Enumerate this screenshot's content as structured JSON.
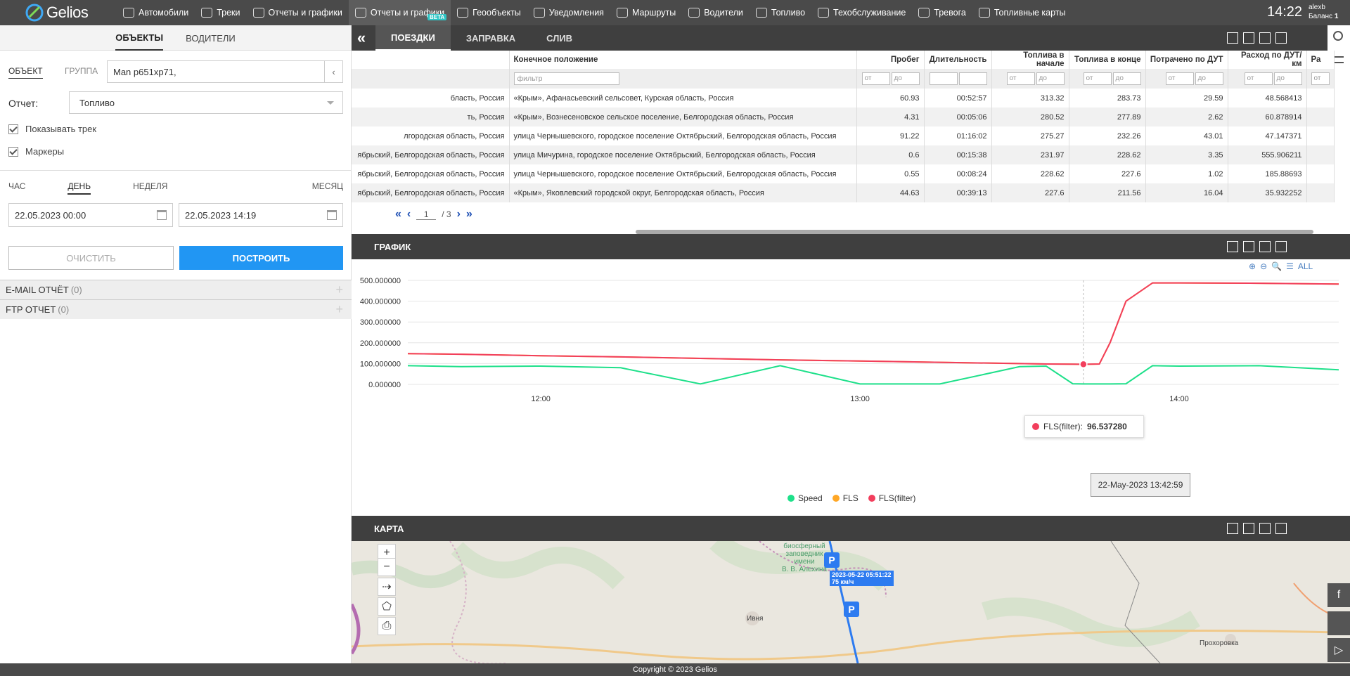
{
  "app": {
    "name": "Gelios",
    "clock": "14:22",
    "user": "alexb",
    "balance_label": "Баланс",
    "balance_value": "1"
  },
  "nav": [
    {
      "label": "Автомобили",
      "icon": "car-icon"
    },
    {
      "label": "Треки",
      "icon": "road-icon"
    },
    {
      "label": "Отчеты и графики",
      "icon": "chart-icon"
    },
    {
      "label": "Отчеты и графики",
      "icon": "chart-icon",
      "badge": "BETA",
      "active": true
    },
    {
      "label": "Геообъекты",
      "icon": "pin-icon"
    },
    {
      "label": "Уведомления",
      "icon": "bell-icon"
    },
    {
      "label": "Маршруты",
      "icon": "route-icon"
    },
    {
      "label": "Водители",
      "icon": "user-icon"
    },
    {
      "label": "Топливо",
      "icon": "fuel-icon"
    },
    {
      "label": "Техобслуживание",
      "icon": "wrench-icon"
    },
    {
      "label": "Тревога",
      "icon": "alarm-icon"
    },
    {
      "label": "Топливные карты",
      "icon": "card-icon"
    }
  ],
  "left": {
    "tabs": [
      "ОБЪЕКТЫ",
      "ВОДИТЕЛИ"
    ],
    "object_label": "ОБЪЕКТ",
    "group_label": "ГРУППА",
    "object_value": "Man р651хр71,",
    "report_label": "Отчет:",
    "report_value": "Топливо",
    "show_track": "Показывать трек",
    "markers": "Маркеры",
    "periods": [
      "ЧАС",
      "ДЕНЬ",
      "НЕДЕЛЯ",
      "МЕСЯЦ"
    ],
    "date_from": "22.05.2023 00:00",
    "date_to": "22.05.2023 14:19",
    "clear_btn": "ОЧИСТИТЬ",
    "build_btn": "ПОСТРОИТЬ",
    "email_report": "E-MAIL ОТЧЁТ",
    "email_count": "(0)",
    "ftp_report": "FTP ОТЧЕТ",
    "ftp_count": "(0)"
  },
  "trips": {
    "tabs": [
      "ПОЕЗДКИ",
      "ЗАПРАВКА",
      "СЛИВ"
    ],
    "headers": [
      "",
      "Конечное положение",
      "Пробег",
      "Длительность",
      "Топлива в начале",
      "Топлива в конце",
      "Потрачено по ДУТ",
      "Расход по ДУТ/км",
      "Ра"
    ],
    "filter_placeholder": "фильтр",
    "from_label": "от",
    "to_label": "до",
    "rows": [
      [
        "бласть, Россия",
        "«Крым», Афанасьевский сельсовет, Курская область, Россия",
        "60.93",
        "00:52:57",
        "313.32",
        "283.73",
        "29.59",
        "48.568413"
      ],
      [
        "ть, Россия",
        "«Крым», Вознесеновское сельское поселение, Белгородская область, Россия",
        "4.31",
        "00:05:06",
        "280.52",
        "277.89",
        "2.62",
        "60.878914"
      ],
      [
        "лгородская область, Россия",
        "улица Чернышевского, городское поселение Октябрьский, Белгородская область, Россия",
        "91.22",
        "01:16:02",
        "275.27",
        "232.26",
        "43.01",
        "47.147371"
      ],
      [
        "ябрьский, Белгородская область, Россия",
        "улица Мичурина, городское поселение Октябрьский, Белгородская область, Россия",
        "0.6",
        "00:15:38",
        "231.97",
        "228.62",
        "3.35",
        "555.906211"
      ],
      [
        "ябрьский, Белгородская область, Россия",
        "улица Чернышевского, городское поселение Октябрьский, Белгородская область, Россия",
        "0.55",
        "00:08:24",
        "228.62",
        "227.6",
        "1.02",
        "185.88693"
      ],
      [
        "ябрьский, Белгородская область, Россия",
        "«Крым», Яковлевский городской округ, Белгородская область, Россия",
        "44.63",
        "00:39:13",
        "227.6",
        "211.56",
        "16.04",
        "35.932252"
      ]
    ],
    "page": "1",
    "pages": "/ 3"
  },
  "chart_panel": {
    "title": "ГРАФИК",
    "all_label": "ALL"
  },
  "chart_data": {
    "type": "line",
    "title": "",
    "xlabel": "",
    "ylabel": "",
    "x_ticks": [
      "12:00",
      "13:00",
      "14:00"
    ],
    "y_ticks": [
      "0.000000",
      "100.000000",
      "200.000000",
      "300.000000",
      "400.000000",
      "500.000000"
    ],
    "ylim": [
      0,
      500
    ],
    "x": [
      "11:35",
      "11:45",
      "12:00",
      "12:15",
      "12:30",
      "12:45",
      "13:00",
      "13:15",
      "13:30",
      "13:35",
      "13:40",
      "13:42",
      "13:45",
      "13:47",
      "13:50",
      "13:55",
      "14:00",
      "14:15",
      "14:30"
    ],
    "series": [
      {
        "name": "Speed",
        "color": "#1ee08a",
        "values": [
          90,
          85,
          88,
          80,
          2,
          90,
          2,
          2,
          85,
          88,
          3,
          2,
          2,
          2,
          3,
          90,
          88,
          90,
          70
        ]
      },
      {
        "name": "FLS",
        "color": "#ffa726",
        "values": [
          148,
          145,
          138,
          132,
          125,
          118,
          112,
          106,
          100,
          98,
          97,
          96,
          98,
          200,
          400,
          488,
          488,
          486,
          482
        ]
      },
      {
        "name": "FLS(filter)",
        "color": "#f23e5c",
        "values": [
          148,
          145,
          138,
          132,
          125,
          118,
          112,
          106,
          100,
          98,
          97,
          96.53728,
          98,
          200,
          400,
          488,
          488,
          486,
          482
        ]
      }
    ],
    "tooltip": {
      "series": "FLS(filter):",
      "value": "96.537280",
      "time": "22-May-2023 13:42:59"
    },
    "legend": [
      "Speed",
      "FLS",
      "FLS(filter)"
    ],
    "grid": true
  },
  "map_panel": {
    "title": "КАРТА",
    "labels": [
      {
        "text": "биосферный"
      },
      {
        "text": "заповедник"
      },
      {
        "text": "имени"
      },
      {
        "text": "В. В. Алехина"
      },
      {
        "text": "Ивня"
      },
      {
        "text": "Прохоровка"
      }
    ],
    "marker_time": "2023-05-22 05:51:22",
    "marker_speed": "75 км/ч",
    "parking_label": "P"
  },
  "footer": "Copyright © 2023 Gelios"
}
